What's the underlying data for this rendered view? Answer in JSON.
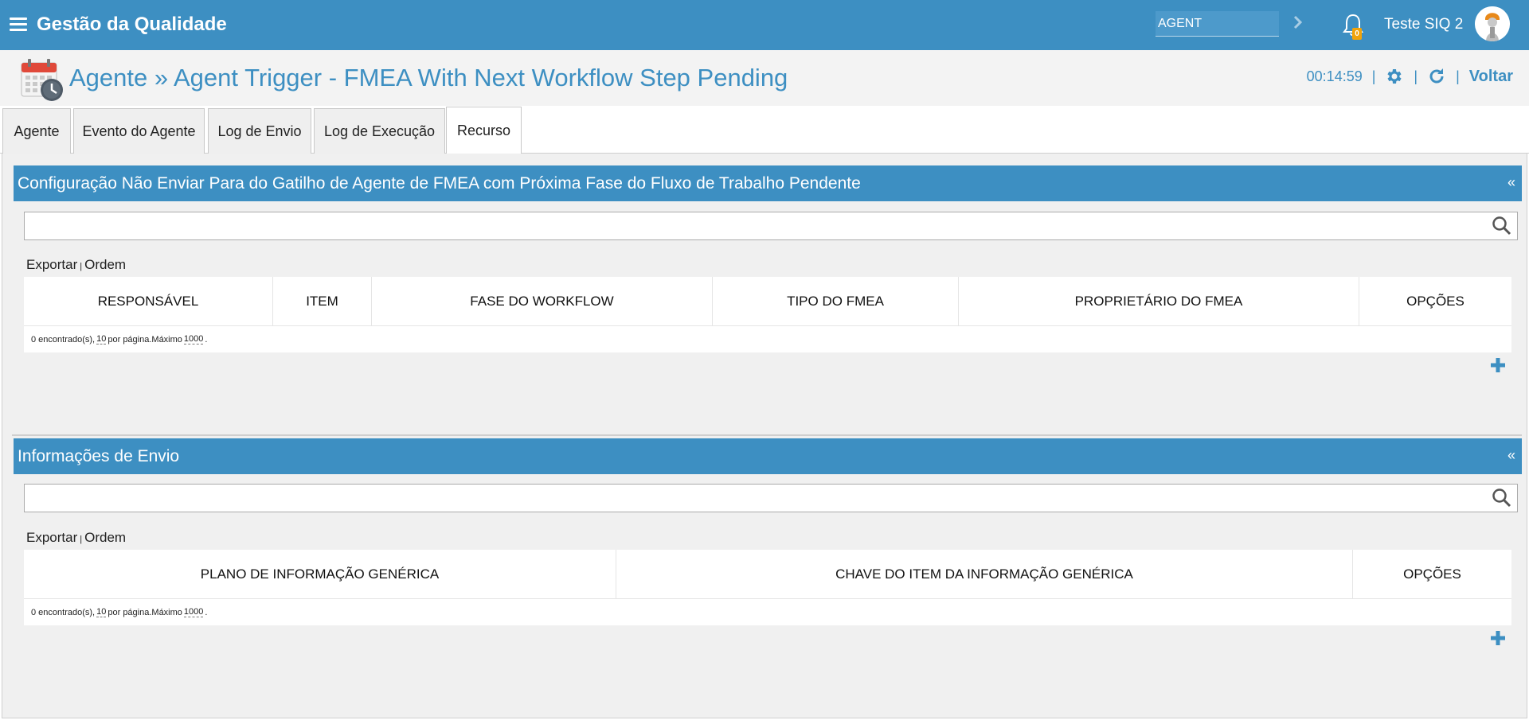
{
  "topbar": {
    "app_title": "Gestão da Qualidade",
    "agent_search_value": "AGENT",
    "notification_count": "0",
    "user_name": "Teste SIQ 2"
  },
  "header": {
    "title": "Agente » Agent Trigger - FMEA With Next Workflow Step Pending",
    "timer": "00:14:59",
    "back_label": "Voltar",
    "separator": "|"
  },
  "tabs": [
    {
      "label": "Agente"
    },
    {
      "label": "Evento do Agente"
    },
    {
      "label": "Log de Envio"
    },
    {
      "label": "Log de Execução"
    },
    {
      "label": "Recurso"
    }
  ],
  "panels": {
    "config": {
      "title": "Configuração Não Enviar Para do Gatilho de Agente de FMEA com Próxima Fase do Fluxo de Trabalho Pendente",
      "collapse": "«",
      "export_label": "Exportar",
      "order_label": "Ordem",
      "pipe": "|",
      "columns": [
        "RESPONSÁVEL",
        "ITEM",
        "FASE DO WORKFLOW",
        "TIPO DO FMEA",
        "PROPRIETÁRIO DO FMEA",
        "OPÇÕES"
      ],
      "footer": {
        "found": "0 encontrado(s),",
        "per_page_value": "10",
        "per_page_text": "por página.Máximo",
        "max_value": "1000",
        "end": "."
      }
    },
    "sending": {
      "title": "Informações de Envio",
      "collapse": "«",
      "export_label": "Exportar",
      "order_label": "Ordem",
      "pipe": "|",
      "columns": [
        "PLANO DE INFORMAÇÃO GENÉRICA",
        "CHAVE DO ITEM DA INFORMAÇÃO GENÉRICA",
        "OPÇÕES"
      ],
      "footer": {
        "found": "0 encontrado(s),",
        "per_page_value": "10",
        "per_page_text": "por página.Máximo",
        "max_value": "1000",
        "end": "."
      }
    }
  },
  "colors": {
    "primary": "#3d8fc2",
    "badge": "#f0a30a",
    "content_bg": "#f0f0f0"
  }
}
